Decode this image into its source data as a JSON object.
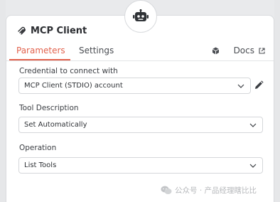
{
  "node": {
    "title": "MCP Client",
    "badge_icon": "robot-icon",
    "title_icon": "mcp-logo-icon"
  },
  "tabs": {
    "parameters": "Parameters",
    "settings": "Settings",
    "docs": "Docs"
  },
  "fields": {
    "credential": {
      "label": "Credential to connect with",
      "value": "MCP Client (STDIO) account"
    },
    "tool_description": {
      "label": "Tool Description",
      "value": "Set Automatically"
    },
    "operation": {
      "label": "Operation",
      "value": "List Tools"
    }
  },
  "watermark": {
    "text": "公众号 · 产品经理瞎比比"
  },
  "colors": {
    "accent": "#e2624d",
    "text": "#2b2d31",
    "border": "#d5d7da"
  }
}
